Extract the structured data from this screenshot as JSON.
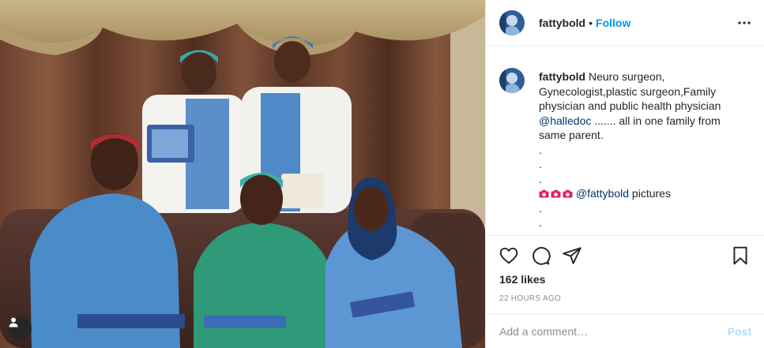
{
  "post": {
    "username": "fattybold",
    "follow_label": "Follow",
    "separator": "•",
    "caption": {
      "username": "fattybold",
      "text_lines": [
        "Neuro surgeon,",
        "Gynecologist,plastic surgeon,Family",
        "physician and public health physician"
      ],
      "mention_line_mention": "@halledoc",
      "mention_line_rest": " ....... all in one family from",
      "line_after": "same parent.",
      "dots": [
        ".",
        ".",
        "."
      ],
      "credit_mention": "@fattybold",
      "credit_rest": " pictures",
      "credit_icons": [
        "camera-emoji-icon",
        "camera-emoji-icon",
        "camera-emoji-icon"
      ],
      "trailing_dots": [
        ".",
        "."
      ]
    },
    "likes": "162 likes",
    "timestamp": "22 HOURS AGO",
    "comment_placeholder": "Add a comment…",
    "post_label": "Post",
    "icons": {
      "more": "more-options-icon",
      "like": "heart-icon",
      "comment": "comment-icon",
      "share": "share-icon",
      "save": "bookmark-icon",
      "tag": "user-tag-icon"
    },
    "colors": {
      "link": "#0095f6",
      "mention": "#00376b",
      "post_disabled": "#b2dffc",
      "muted": "#8e8e8e"
    }
  }
}
